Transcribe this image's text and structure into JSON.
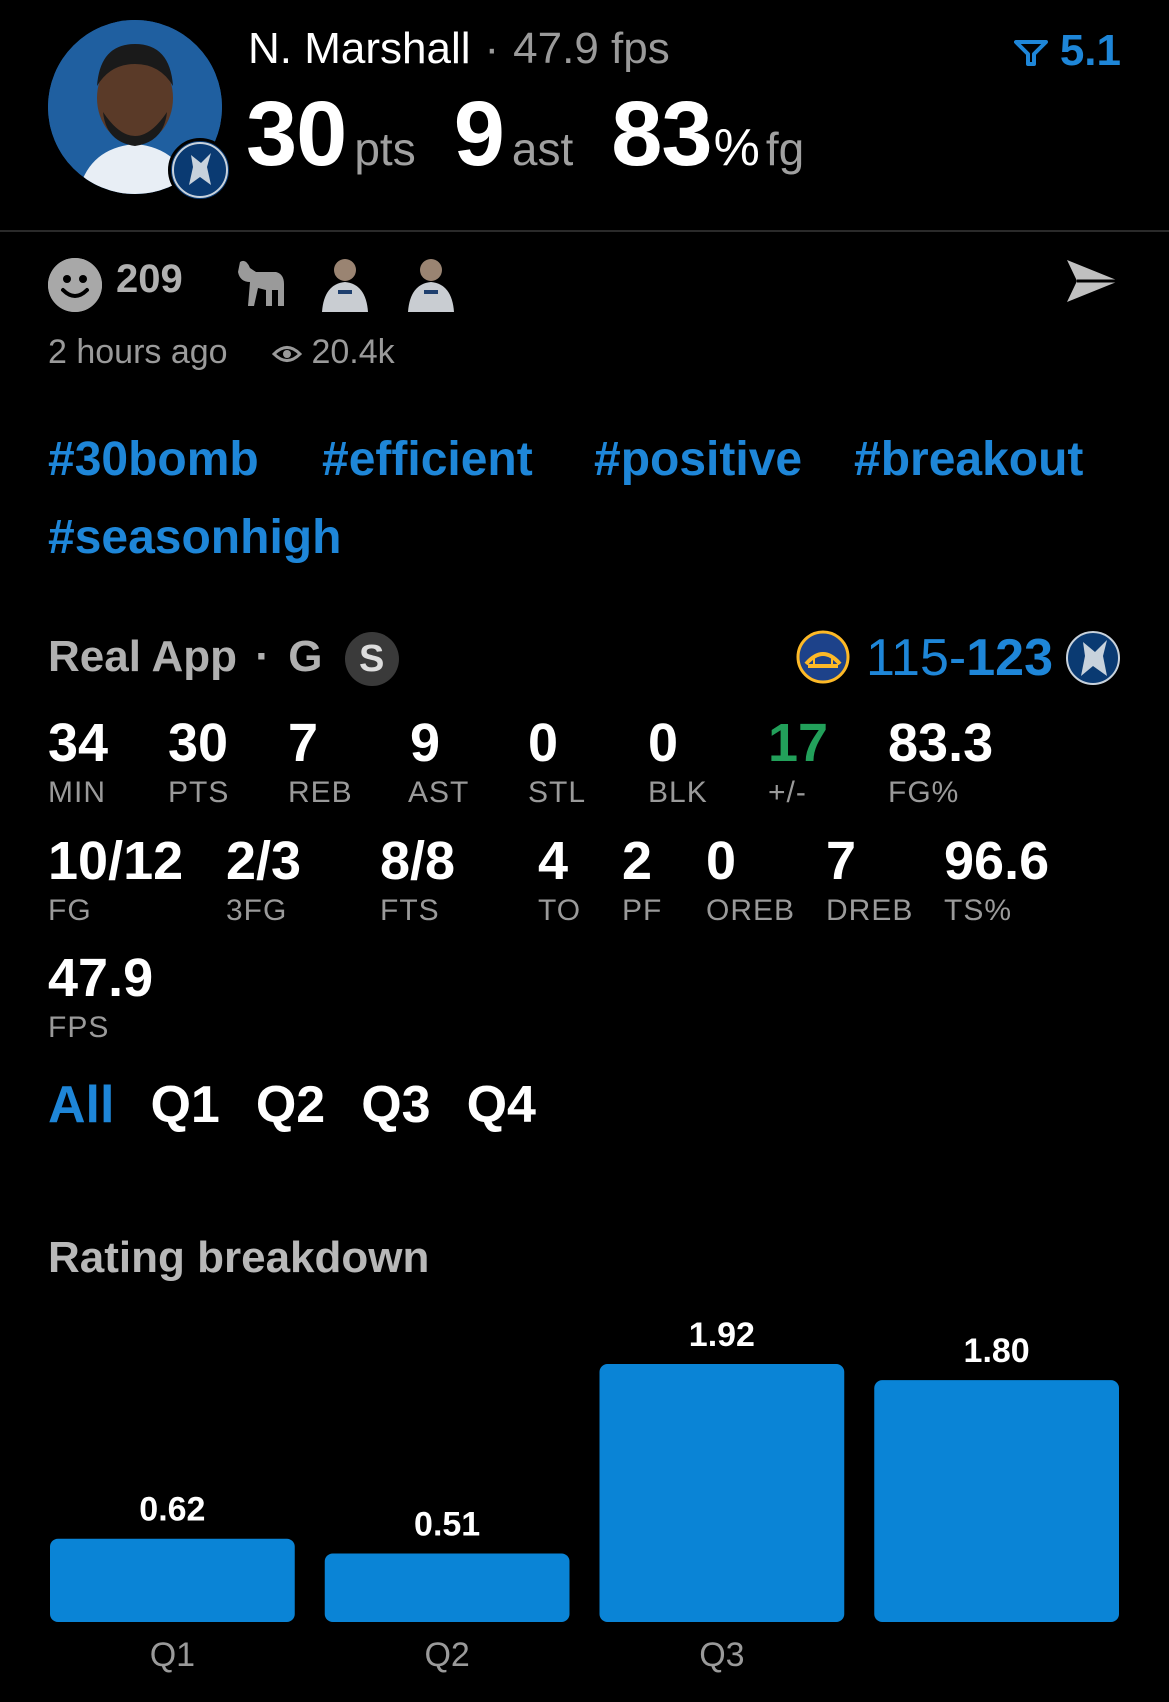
{
  "player": {
    "name": "N. Marshall",
    "fps_headline": "47.9 fps",
    "pts_value": "30",
    "pts_unit": "pts",
    "ast_value": "9",
    "ast_unit": "ast",
    "fg_value": "83",
    "fg_unit": "%",
    "fg_label": "fg",
    "rating_score": "5.1"
  },
  "reactions": {
    "count": "209",
    "time_ago": "2 hours ago",
    "views": "20.4k"
  },
  "hashtags": [
    "#30bomb",
    "#efficient",
    "#positive",
    "#breakout",
    "#seasonhigh"
  ],
  "game": {
    "source": "Real App",
    "position": "G",
    "badge": "S",
    "score_away": "115",
    "score_sep": "-",
    "score_home": "123"
  },
  "stats_row1": [
    {
      "value": "34",
      "label": "MIN"
    },
    {
      "value": "30",
      "label": "PTS"
    },
    {
      "value": "7",
      "label": "REB"
    },
    {
      "value": "9",
      "label": "AST"
    },
    {
      "value": "0",
      "label": "STL"
    },
    {
      "value": "0",
      "label": "BLK"
    },
    {
      "value": "17",
      "label": "+/-"
    },
    {
      "value": "83.3",
      "label": "FG%"
    }
  ],
  "stats_row2": [
    {
      "value": "10/12",
      "label": "FG"
    },
    {
      "value": "2/3",
      "label": "3FG"
    },
    {
      "value": "8/8",
      "label": "FTS"
    },
    {
      "value": "4",
      "label": "TO"
    },
    {
      "value": "2",
      "label": "PF"
    },
    {
      "value": "0",
      "label": "OREB"
    },
    {
      "value": "7",
      "label": "DREB"
    },
    {
      "value": "96.6",
      "label": "TS%"
    }
  ],
  "stats_row3": [
    {
      "value": "47.9",
      "label": "FPS"
    }
  ],
  "tabs": [
    "All",
    "Q1",
    "Q2",
    "Q3",
    "Q4"
  ],
  "breakdown_title": "Rating breakdown",
  "colors": {
    "accent": "#1e86d8",
    "positive": "#22a05a",
    "bar": "#0a84d6"
  },
  "chart_data": {
    "type": "bar",
    "categories": [
      "Q1",
      "Q2",
      "Q3",
      ""
    ],
    "values": [
      0.62,
      0.51,
      1.92,
      1.8
    ],
    "value_labels": [
      "0.62",
      "0.51",
      "1.92",
      "1.80"
    ],
    "ylim": [
      0,
      1.92
    ],
    "grid": false
  }
}
